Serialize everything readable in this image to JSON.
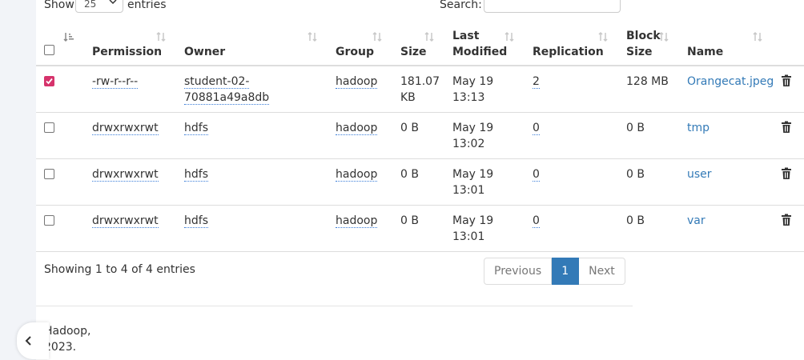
{
  "length_control": {
    "show_label": "Show",
    "selected": "25",
    "entries_label": "entries"
  },
  "search": {
    "label": "Search:",
    "value": ""
  },
  "table": {
    "headers": {
      "permission": "Permission",
      "owner": "Owner",
      "group": "Group",
      "size": "Size",
      "last_modified": "Last Modified",
      "replication": "Replication",
      "block_size": "Block Size",
      "name": "Name"
    },
    "rows": [
      {
        "checked": true,
        "permission": "-rw-r--r--",
        "owner": "student-02-70881a49a8db",
        "group": "hadoop",
        "size": "181.07 KB",
        "last_modified": "May 19 13:13",
        "replication": "2",
        "block_size": "128 MB",
        "name": "Orangecat.jpeg"
      },
      {
        "checked": false,
        "permission": "drwxrwxrwt",
        "owner": "hdfs",
        "group": "hadoop",
        "size": "0 B",
        "last_modified": "May 19 13:02",
        "replication": "0",
        "block_size": "0 B",
        "name": "tmp"
      },
      {
        "checked": false,
        "permission": "drwxrwxrwt",
        "owner": "hdfs",
        "group": "hadoop",
        "size": "0 B",
        "last_modified": "May 19 13:01",
        "replication": "0",
        "block_size": "0 B",
        "name": "user"
      },
      {
        "checked": false,
        "permission": "drwxrwxrwt",
        "owner": "hdfs",
        "group": "hadoop",
        "size": "0 B",
        "last_modified": "May 19 13:01",
        "replication": "0",
        "block_size": "0 B",
        "name": "var"
      }
    ]
  },
  "info": "Showing 1 to 4 of 4 entries",
  "pagination": {
    "previous": "Previous",
    "current": "1",
    "next": "Next"
  },
  "footer": {
    "line1": "Hadoop,",
    "line2": "2023."
  },
  "icons": {
    "sort": "sort-both-icon",
    "sort_active": "sort-ascending-icon",
    "delete": "trash-icon",
    "collapse": "chevron-left-icon"
  },
  "colors": {
    "link": "#337ab7",
    "active_page": "#337ab7",
    "checkbox_checked": "#d6336c"
  }
}
